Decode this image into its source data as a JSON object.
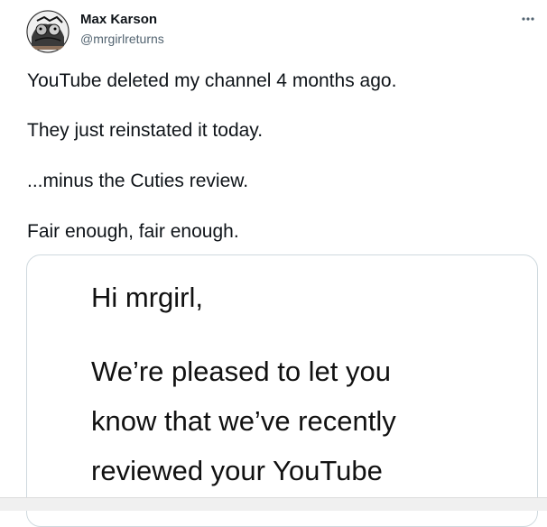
{
  "tweet": {
    "author": {
      "name": "Max Karson",
      "handle": "@mrgirlreturns",
      "avatar": "profile-avatar-illustration"
    },
    "more_icon": "ellipsis-icon",
    "paragraphs": [
      "YouTube deleted my channel 4 months ago.",
      "They just reinstated it today.",
      "...minus the Cuties review.",
      "Fair enough, fair enough."
    ],
    "media": {
      "lines": [
        "Hi mrgirl,",
        "We’re pleased to let you",
        "know that we’ve recently",
        "reviewed your YouTube"
      ]
    }
  },
  "colors": {
    "text": "#0f1419",
    "secondary": "#536471",
    "border": "#cfd9de"
  }
}
